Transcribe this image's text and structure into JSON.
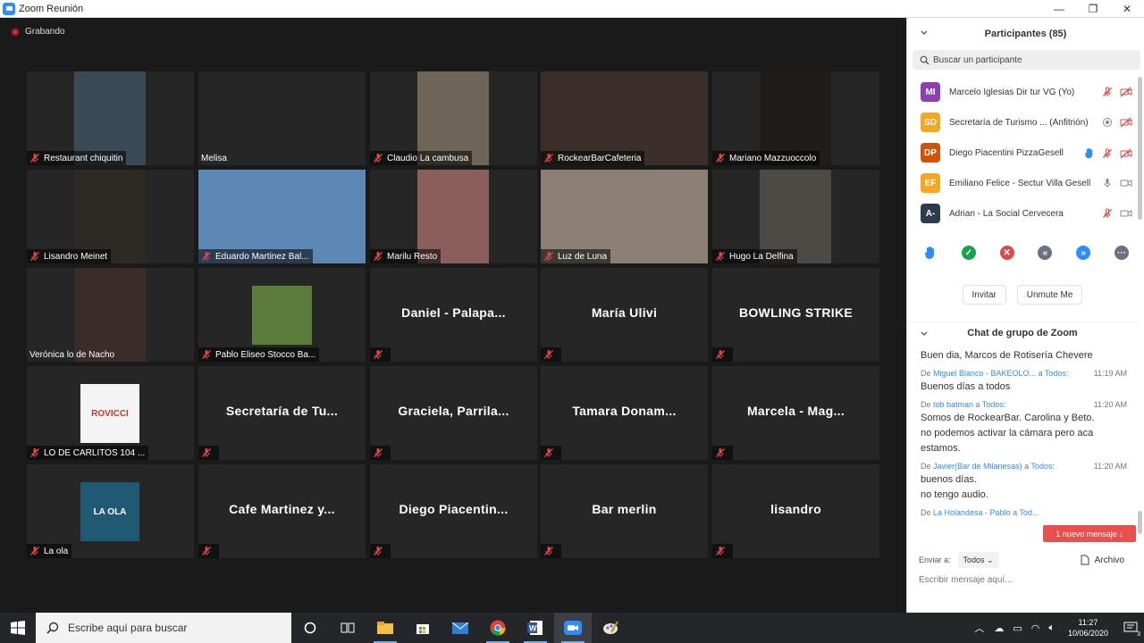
{
  "window": {
    "title": "Zoom Reunión",
    "minimize": "—",
    "maximize": "❐",
    "close": "✕"
  },
  "recording": {
    "label": "Grabando"
  },
  "tiles": [
    {
      "row": 0,
      "col": 0,
      "label": "Restaurant chiquitin",
      "video": "#3b4a57"
    },
    {
      "row": 0,
      "col": 1,
      "label": "Melisa",
      "bare": true
    },
    {
      "row": 0,
      "col": 2,
      "label": "Claudio La cambusa",
      "video": "#6f6458"
    },
    {
      "row": 0,
      "col": 3,
      "label": "RockearBarCafeteria",
      "video": "#3c2f29"
    },
    {
      "row": 0,
      "col": 4,
      "label": "Mariano Mazzuoccolo",
      "video": "#1f1d1c"
    },
    {
      "row": 1,
      "col": 0,
      "label": "Lisandro Meinet",
      "video": "#2d2a24"
    },
    {
      "row": 1,
      "col": 1,
      "label": "Eduardo Martinez  Bal...",
      "video": "#5d87b5"
    },
    {
      "row": 1,
      "col": 2,
      "label": "Marilu Resto",
      "video": "#8a5e5a"
    },
    {
      "row": 1,
      "col": 3,
      "label": "Luz de Luna",
      "video": "#8c7f74"
    },
    {
      "row": 1,
      "col": 4,
      "label": "Hugo La Delfina",
      "video": "#4d4a46"
    },
    {
      "row": 2,
      "col": 0,
      "label": "Verónica lo de Nacho",
      "video": "#3a2c28",
      "bare": true
    },
    {
      "row": 2,
      "col": 1,
      "label": "Pablo Eliseo Stocco Ba...",
      "video": "#5b7d3c"
    },
    {
      "row": 2,
      "col": 2,
      "bigname": "Daniel  -  Palapa..."
    },
    {
      "row": 2,
      "col": 3,
      "bigname": "María Ulivi"
    },
    {
      "row": 2,
      "col": 4,
      "bigname": "BOWLING STRIKE"
    },
    {
      "row": 3,
      "col": 0,
      "label": "LO DE CARLITOS 104 ...",
      "logo": "ROVICCI",
      "video": "#f4f4f4"
    },
    {
      "row": 3,
      "col": 1,
      "bigname": "Secretaría de Tu..."
    },
    {
      "row": 3,
      "col": 2,
      "bigname": "Graciela,  Parrila..."
    },
    {
      "row": 3,
      "col": 3,
      "bigname": "Tamara  Donam..."
    },
    {
      "row": 3,
      "col": 4,
      "bigname": "Marcela  -  Mag..."
    },
    {
      "row": 4,
      "col": 0,
      "label": "La ola",
      "logo": "LA OLA",
      "video": "#1f5a72"
    },
    {
      "row": 4,
      "col": 1,
      "bigname": "Cafe Martinez y..."
    },
    {
      "row": 4,
      "col": 2,
      "bigname": "Diego  Piacentin..."
    },
    {
      "row": 4,
      "col": 3,
      "bigname": "Bar merlin"
    },
    {
      "row": 4,
      "col": 4,
      "bigname": "lisandro"
    }
  ],
  "participants": {
    "title": "Participantes (85)",
    "search_placeholder": "Buscar un participante",
    "list": [
      {
        "initials": "MI",
        "color": "#8c3fb0",
        "name": "Marcelo Iglesias Dir tur VG (Yo)",
        "icons": [
          "mic-off",
          "cam-off"
        ]
      },
      {
        "initials": "SD",
        "color": "#f5a623",
        "name": "Secretaría de Turismo ...  (Anfitrión)",
        "icons": [
          "record",
          "cam-off"
        ]
      },
      {
        "initials": "DP",
        "color": "#d0530a",
        "name": "Diego Piacentini PizzaGesell",
        "icons": [
          "hand",
          "mic-off",
          "cam-off"
        ]
      },
      {
        "initials": "EF",
        "color": "#f5a623",
        "name": "Emiliano Felice - Sectur Villa Gesell",
        "icons": [
          "mic",
          "cam"
        ]
      },
      {
        "initials": "A-",
        "color": "#2c3b4e",
        "name": "Adrian - La Social Cervecera",
        "icons": [
          "mic-off",
          "cam"
        ]
      }
    ],
    "buttons": {
      "invite": "Invitar",
      "unmute": "Unmute Me"
    }
  },
  "chat": {
    "title": "Chat de grupo de Zoom",
    "messages": [
      {
        "from": "",
        "to": "",
        "time": "",
        "text": [
          "Buen dia, Marcos de Rotisería Chevere"
        ]
      },
      {
        "from": "Miguel Blanco - BAKEOLO...",
        "to": "Todos:",
        "time": "11:19 AM",
        "text": [
          "Buenos días a todos"
        ]
      },
      {
        "from": "tob batman",
        "to": "Todos:",
        "time": "11:20 AM",
        "text": [
          "Somos de RockearBar. Carolina y Beto.",
          "no podemos activar la cámara pero aca",
          "estamos."
        ]
      },
      {
        "from": "Javier(Bar de Milanesas)",
        "to": "Todos:",
        "time": "11:20 AM",
        "text": [
          "buenos días.",
          "no tengo audio."
        ]
      },
      {
        "from": "La Holandesa - Pablo",
        "to": "Tod...",
        "time": "",
        "text": []
      }
    ],
    "new_message": "1 nuevo mensaje ↓",
    "send_to_label": "Enviar a:",
    "send_to_value": "Todos",
    "file_label": "Archivo",
    "compose_placeholder": "Escribir mensaje aquí..."
  },
  "taskbar": {
    "search_placeholder": "Escribe aquí para buscar",
    "time": "11:27",
    "date": "10/06/2020",
    "notifications": "3"
  }
}
